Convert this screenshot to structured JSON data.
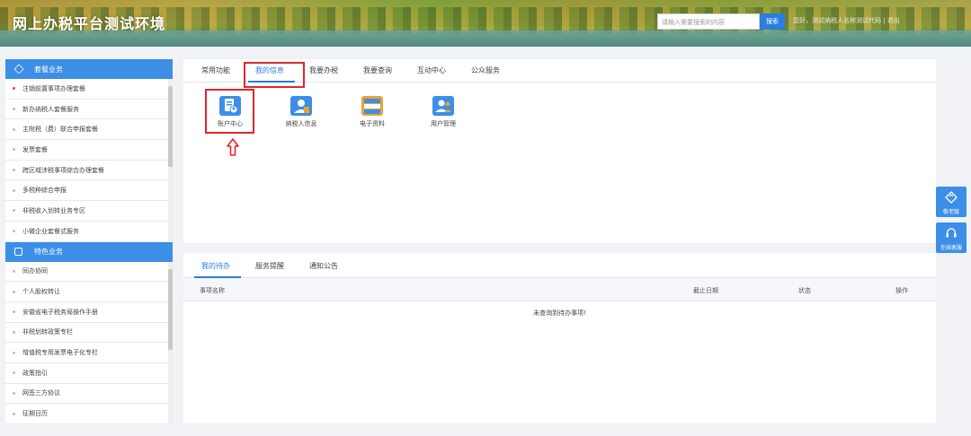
{
  "header": {
    "title": "网上办税平台测试环境",
    "search_placeholder": "请输入需要搜索的内容",
    "search_button": "搜索",
    "user_info": "您好，测试纳税人名称测试代码  |  退出"
  },
  "sidebar": {
    "section1": {
      "title": "套餐业务",
      "items": [
        "注销前置事项办理套餐",
        "新办纳税人套餐服务",
        "主附税（费）联合申报套餐",
        "发票套餐",
        "跨区域涉税事项综合办理套餐",
        "多税种综合申报",
        "非税收入划转业务专区",
        "小微企业套餐式服务"
      ]
    },
    "section2": {
      "title": "特色业务",
      "items": [
        "同办协同",
        "个人股权转让",
        "安徽省电子税务局操作手册",
        "非税划转政策专栏",
        "增值税专用发票电子化专栏",
        "政策指引",
        "网签三方协议",
        "征期日历"
      ]
    }
  },
  "main": {
    "tabs": [
      "常用功能",
      "我的信息",
      "我要办税",
      "我要查询",
      "互动中心",
      "公众服务"
    ],
    "active_tab": "我的信息",
    "apps": [
      {
        "label": "账户中心",
        "icon": "account-center-icon"
      },
      {
        "label": "纳税人信息",
        "icon": "taxpayer-info-icon"
      },
      {
        "label": "电子资料",
        "icon": "electronic-docs-icon"
      },
      {
        "label": "用户管理",
        "icon": "user-management-icon"
      }
    ]
  },
  "todo": {
    "tabs": [
      "我的待办",
      "服务提醒",
      "通知公告"
    ],
    "columns": [
      "事项名称",
      "截止日期",
      "状态",
      "操作"
    ],
    "empty_text": "未查询到待办事项!"
  },
  "float": {
    "elderly": "敬老版",
    "online_service": "在线客服"
  },
  "colors": {
    "accent": "#2a7ee0",
    "sidebar_header": "#3d8ee6",
    "highlight": "#e2262b"
  }
}
